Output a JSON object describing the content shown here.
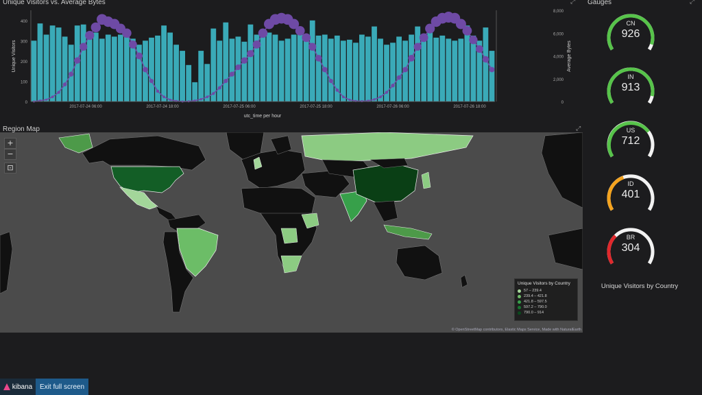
{
  "chart_panel": {
    "title": "Unique Visitors vs. Average Bytes"
  },
  "chart_data": {
    "type": "bar",
    "title": "Unique Visitors vs. Average Bytes",
    "xlabel": "utc_time per hour",
    "ylabel_left": "Unique Visitors",
    "ylabel_right": "Average Bytes",
    "ylim_left": [
      0,
      450
    ],
    "ylim_right": [
      0,
      8000
    ],
    "yticks_left": [
      "0",
      "100",
      "200",
      "300",
      "400"
    ],
    "yticks_right": [
      "0",
      "2,000",
      "4,000",
      "6,000",
      "8,000"
    ],
    "xticks": [
      "2017-07-24 06:00",
      "2017-07-24 18:00",
      "2017-07-25 06:00",
      "2017-07-25 18:00",
      "2017-07-26 06:00",
      "2017-07-26 18:00"
    ],
    "bar_color": "#3aaab8",
    "line_color": "#6e4aa5",
    "bars": [
      300,
      385,
      330,
      375,
      365,
      320,
      280,
      375,
      380,
      320,
      340,
      310,
      330,
      320,
      330,
      325,
      310,
      280,
      300,
      315,
      325,
      375,
      340,
      280,
      250,
      180,
      95,
      250,
      185,
      360,
      300,
      390,
      310,
      320,
      295,
      380,
      330,
      325,
      340,
      330,
      300,
      310,
      330,
      355,
      315,
      400,
      325,
      330,
      310,
      325,
      300,
      305,
      290,
      330,
      320,
      370,
      310,
      280,
      290,
      320,
      300,
      330,
      370,
      310,
      350,
      315,
      325,
      310,
      300,
      310,
      375,
      325,
      300,
      365,
      250
    ],
    "avg_bytes": [
      0,
      80,
      160,
      400,
      800,
      1500,
      2400,
      3600,
      4800,
      5800,
      6500,
      7200,
      7000,
      6800,
      6400,
      6000,
      5000,
      4000,
      2800,
      1800,
      900,
      400,
      150,
      50,
      0,
      20,
      80,
      200,
      400,
      700,
      1200,
      1800,
      2400,
      3000,
      3600,
      4200,
      5000,
      6000,
      6800,
      7200,
      7300,
      7200,
      6800,
      6200,
      5600,
      4800,
      3800,
      2800,
      1800,
      1000,
      400,
      150,
      50,
      30,
      60,
      180,
      400,
      800,
      1400,
      2100,
      2800,
      3800,
      4800,
      5600,
      6400,
      7000,
      7300,
      7400,
      7300,
      6800,
      6200,
      5400,
      4600,
      3700,
      2800
    ]
  },
  "map_panel": {
    "title": "Region Map",
    "zoom_in": "+",
    "zoom_out": "−",
    "fit": "⊡",
    "legend": {
      "title": "Unique Visitors by Country",
      "ranges": [
        "57 – 239.4",
        "239.4 – 421.8",
        "421.8 – 597.5",
        "597.2 – 790.0",
        "790.0 – 914"
      ],
      "colors": [
        "#a7d99b",
        "#6fbe6a",
        "#37a04a",
        "#17772f",
        "#0a4a1c"
      ]
    },
    "attribution": "© OpenStreetMap contributors, Elastic Maps Service, Made with NaturalEarth"
  },
  "gauges_panel": {
    "title": "Gauges",
    "label": "Unique Visitors by Country",
    "gauges": [
      {
        "name": "CN",
        "value": "926",
        "fraction": 0.94,
        "color": "#57c34a"
      },
      {
        "name": "IN",
        "value": "913",
        "fraction": 0.92,
        "color": "#57c34a"
      },
      {
        "name": "US",
        "value": "712",
        "fraction": 0.72,
        "color": "#57c34a"
      },
      {
        "name": "ID",
        "value": "401",
        "fraction": 0.42,
        "color": "#f4a31e"
      },
      {
        "name": "BR",
        "value": "304",
        "fraction": 0.32,
        "color": "#e0282c"
      }
    ]
  },
  "bottom_bar": {
    "logo": "kibana",
    "exit_label": "Exit full screen"
  }
}
